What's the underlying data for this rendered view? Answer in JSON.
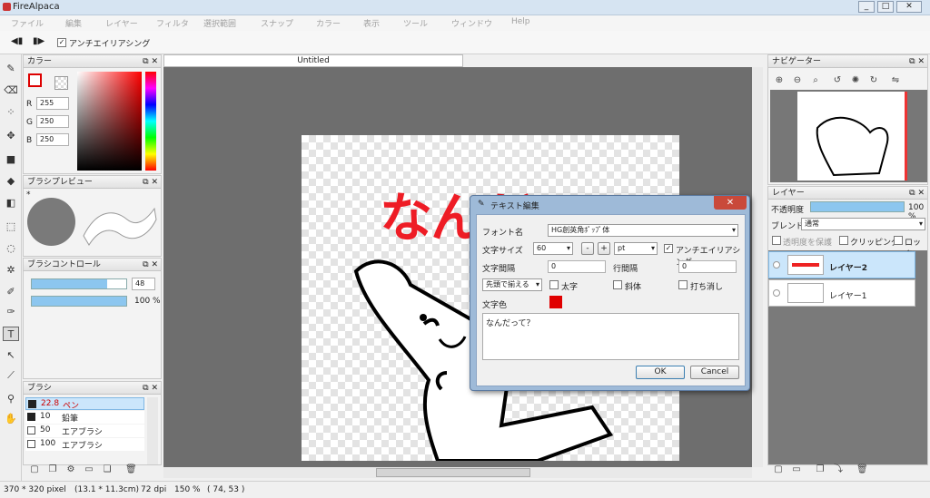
{
  "window": {
    "title": "FireAlpaca",
    "min": "_",
    "max": "□",
    "close": "✕"
  },
  "menu": [
    "ファイル",
    "編集",
    "レイヤー",
    "フィルタ",
    "選択範囲",
    "スナップ",
    "カラー",
    "表示",
    "ツール",
    "ウィンドウ",
    "Help"
  ],
  "toolbar": {
    "antialias_label": "アンチエイリアシング",
    "antialias_checked": "✓"
  },
  "color_panel": {
    "title": "カラー",
    "r_label": "R",
    "r": "255",
    "g_label": "G",
    "g": "250",
    "b_label": "B",
    "b": "250"
  },
  "brush_preview": {
    "title": "ブラシプレビュー",
    "star": "*"
  },
  "brush_control": {
    "title": "ブラシコントロール",
    "size": "48",
    "opacity": "100 %"
  },
  "brush_panel": {
    "title": "ブラシ",
    "items": [
      {
        "size": "22.8",
        "name": "ペン"
      },
      {
        "size": "10",
        "name": "鉛筆"
      },
      {
        "size": "50",
        "name": "エアブラシ"
      },
      {
        "size": "100",
        "name": "エアブラシ"
      }
    ]
  },
  "document": {
    "tab": "Untitled",
    "big_text": "なんだって"
  },
  "dialog": {
    "title": "テキスト編集",
    "font_label": "フォント名",
    "font_value": "HG創英角ﾎﾟｯﾌﾟ体",
    "size_label": "文字サイズ",
    "size_value": "60",
    "size_unit": "pt",
    "antialias_label": "アンチエイリアシング",
    "spacing_label": "文字間隔",
    "spacing_value": "0",
    "line_label": "行間隔",
    "line_value": "0",
    "align_value": "先頭で揃える",
    "bold_label": "太字",
    "italic_label": "斜体",
    "strike_label": "打ち消し",
    "color_label": "文字色",
    "text_value": "なんだって？",
    "ok": "OK",
    "cancel": "Cancel",
    "minus": "-",
    "plus": "+",
    "check": "✓",
    "text_color": "#e00000"
  },
  "navigator": {
    "title": "ナビゲーター"
  },
  "layer_panel": {
    "title": "レイヤー",
    "opacity_label": "不透明度",
    "opacity_value": "100 %",
    "blend_label": "ブレンド",
    "blend_value": "通常",
    "protect_label": "透明度を保護",
    "clip_label": "クリッピング",
    "lock_label": "ロック",
    "layers": [
      {
        "name": "レイヤー2"
      },
      {
        "name": "レイヤー1"
      }
    ]
  },
  "status": {
    "size": "370 * 320 pixel",
    "cm": "(13.1 * 11.3cm)",
    "dpi": "72 dpi",
    "zoom": "150 %",
    "coord": "( 74, 53 )"
  }
}
